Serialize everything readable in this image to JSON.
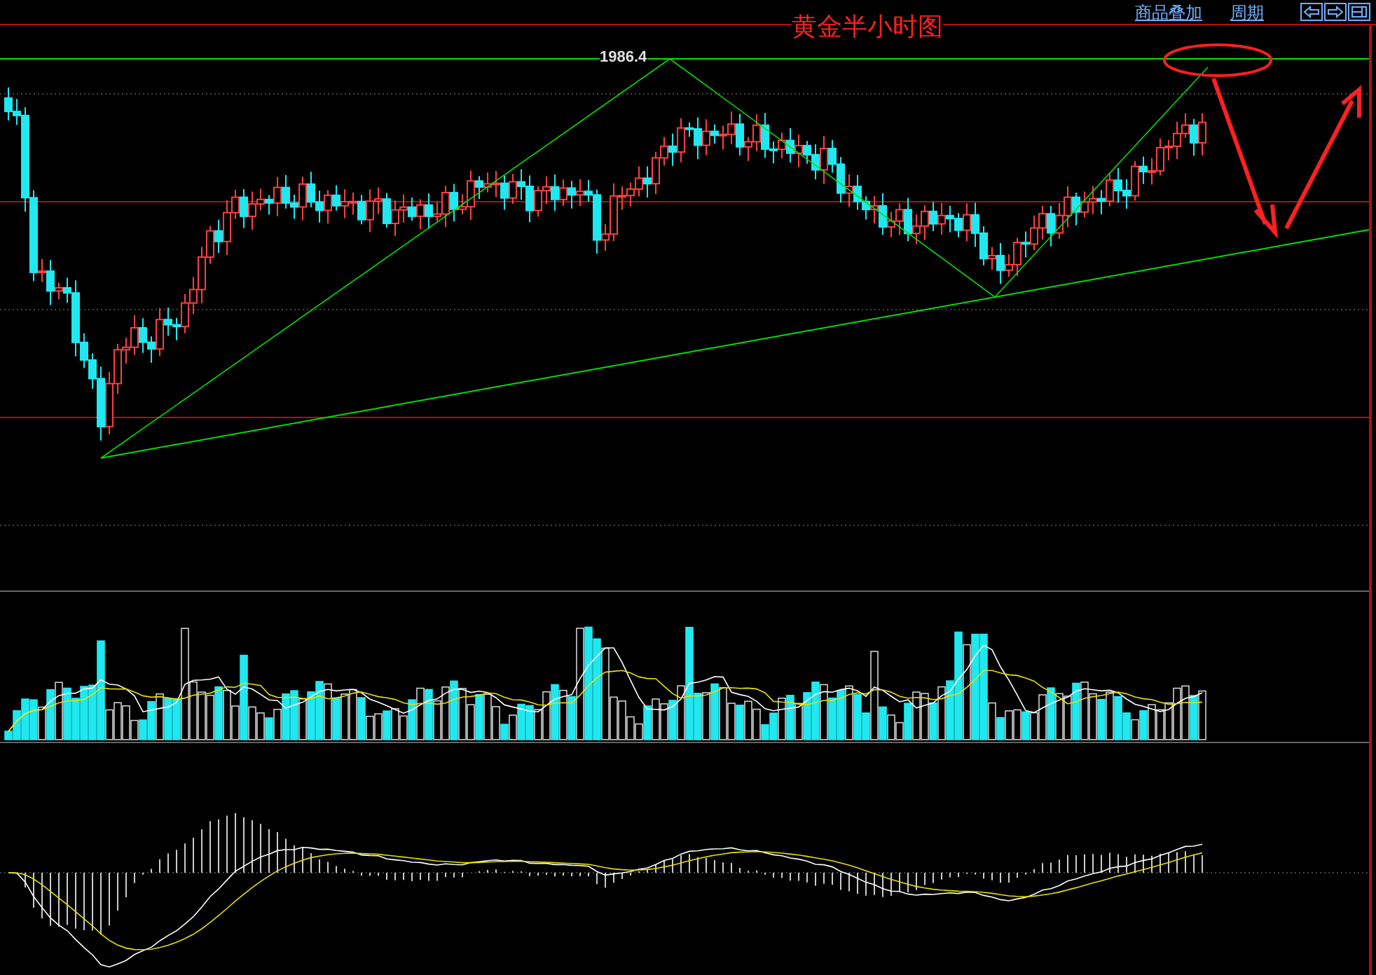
{
  "chart_title": "黄金半小时图",
  "peak_label": "1986.4",
  "toolbar_links": [
    {
      "label": "商品叠加"
    },
    {
      "label": "周期"
    }
  ]
}
